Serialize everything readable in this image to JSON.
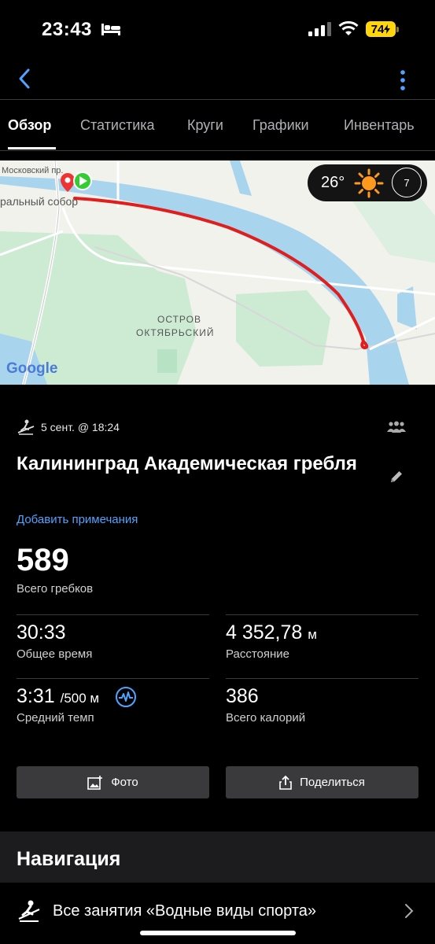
{
  "status_bar": {
    "time": "23:43",
    "battery": "74"
  },
  "tabs": [
    "Обзор",
    "Статистика",
    "Круги",
    "Графики",
    "Инвентарь"
  ],
  "map": {
    "labels": [
      "Московский пр.",
      "ральный собор",
      "ОСТРОВ",
      "ОКТЯБРЬСКИЙ"
    ],
    "google": "Google",
    "weather_temp": "26°",
    "wind_speed": "7"
  },
  "activity": {
    "meta": "5 сент. @ 18:24",
    "title": "Калининград Академическая гребля",
    "add_note": "Добавить примечания",
    "total_strokes": "589",
    "total_strokes_label": "Всего гребков"
  },
  "stats": {
    "total_time": "30:33",
    "total_time_label": "Общее время",
    "distance": "4 352,78",
    "distance_unit": "м",
    "distance_label": "Расстояние",
    "avg_pace": "3:31",
    "avg_pace_unit": "/500 м",
    "avg_pace_label": "Средний темп",
    "calories": "386",
    "calories_label": "Всего калорий"
  },
  "buttons": {
    "photo": "Фото",
    "share": "Поделиться"
  },
  "navigation": {
    "heading": "Навигация",
    "all_activities": "Все занятия «Водные виды спорта»"
  },
  "colors": {
    "accent": "#4ea4ff",
    "route": "#e01e1e",
    "battery": "#ffd60a",
    "water": "#a9d4ee",
    "park": "#cdebd3"
  }
}
